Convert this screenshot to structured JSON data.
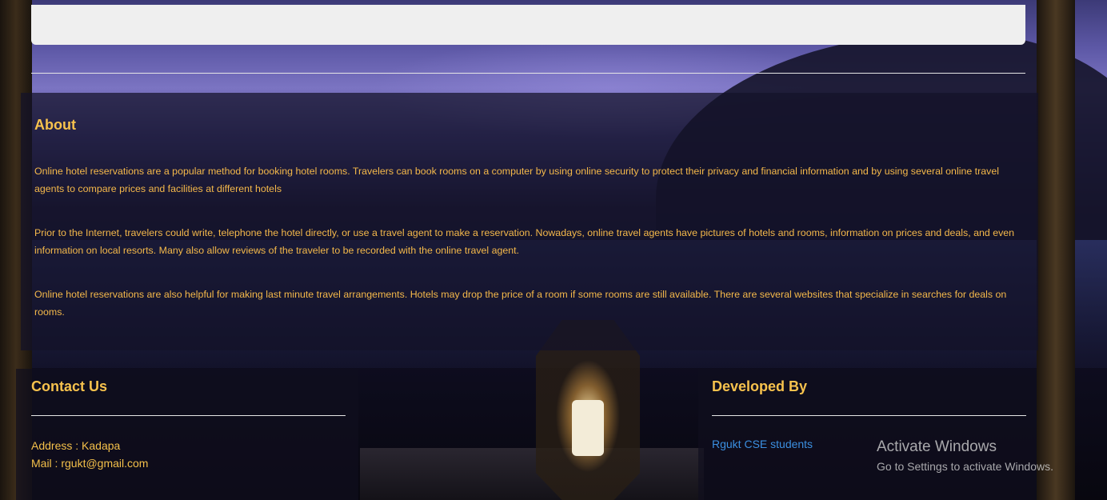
{
  "about": {
    "title": "About",
    "paragraphs": [
      "Online hotel reservations are a popular method for booking hotel rooms. Travelers can book rooms on a computer by using online security to protect their privacy and financial information and by using several online travel agents to compare prices and facilities at different hotels",
      "Prior to the Internet, travelers could write, telephone the hotel directly, or use a travel agent to make a reservation. Nowadays, online travel agents have pictures of hotels and rooms, information on prices and deals, and even information on local resorts. Many also allow reviews of the traveler to be recorded with the online travel agent.",
      "Online hotel reservations are also helpful for making last minute travel arrangements. Hotels may drop the price of a room if some rooms are still available. There are several websites that specialize in searches for deals on rooms."
    ]
  },
  "contact": {
    "title": "Contact Us",
    "address": "Address : Kadapa",
    "mail": "Mail : rgukt@gmail.com"
  },
  "developer": {
    "title": "Developed By",
    "link": "Rgukt CSE students"
  },
  "watermark": {
    "line1": "Activate Windows",
    "line2": "Go to Settings to activate Windows."
  },
  "colors": {
    "heading": "#f7c24d",
    "body_text": "#f4b84a",
    "link": "#3b8fe0"
  }
}
